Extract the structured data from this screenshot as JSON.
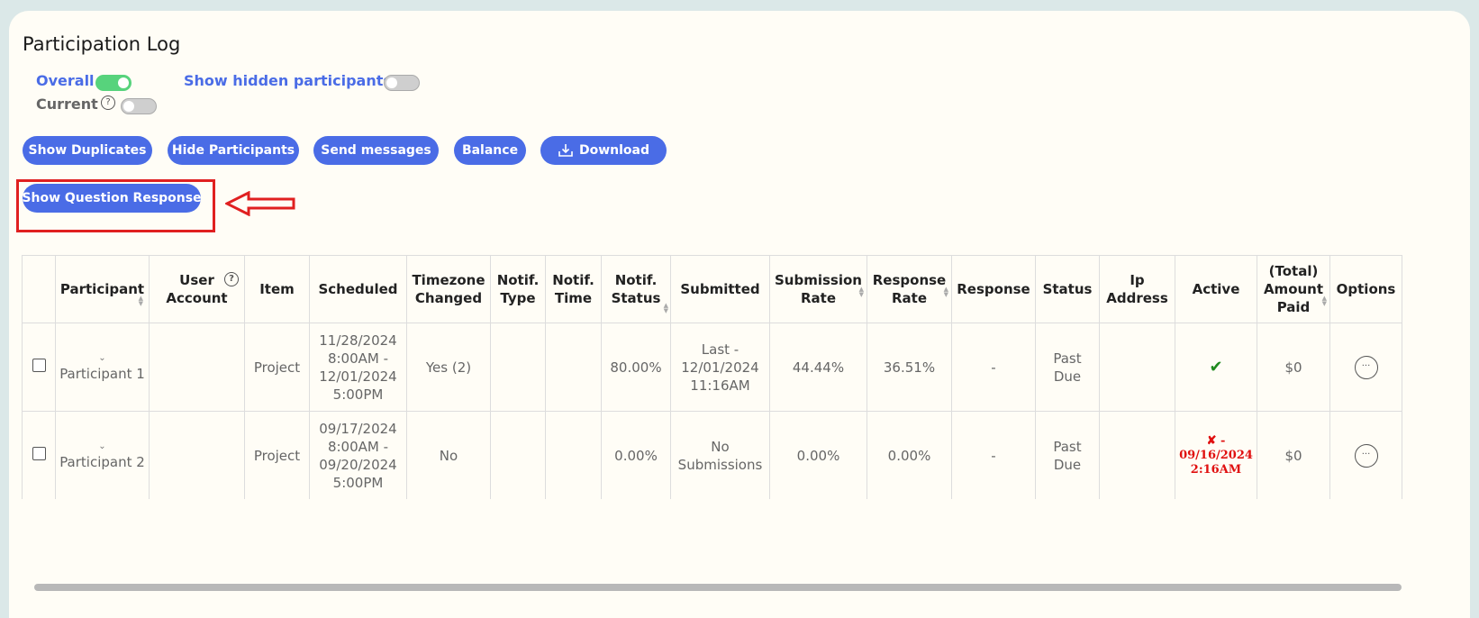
{
  "page": {
    "title": "Participation Log"
  },
  "toggles": {
    "overall_label": "Overall",
    "overall_on": true,
    "current_label": "Current",
    "current_on": false,
    "hidden_label": "Show hidden participants",
    "hidden_on": false,
    "help_glyph": "?"
  },
  "actions": {
    "show_duplicates": "Show Duplicates",
    "hide_participants": "Hide Participants",
    "send_messages": "Send messages",
    "balance": "Balance",
    "download": "Download",
    "show_question_response": "Show Question Response"
  },
  "table": {
    "headers": {
      "participant": "Participant",
      "user_account": "User Account",
      "item": "Item",
      "scheduled": "Scheduled",
      "timezone_changed": "Timezone Changed",
      "notif_type": "Notif. Type",
      "notif_time": "Notif. Time",
      "notif_status": "Notif. Status",
      "submitted": "Submitted",
      "submission_rate": "Submission Rate",
      "response_rate": "Response Rate",
      "response": "Response",
      "status": "Status",
      "ip_address": "Ip Address",
      "active": "Active",
      "total_amount_paid": "(Total) Amount Paid",
      "options": "Options"
    },
    "rows": [
      {
        "expand": "⌄",
        "participant": "Participant 1",
        "user_account": "",
        "item": "Project",
        "scheduled_1": "11/28/2024",
        "scheduled_2": "8:00AM -",
        "scheduled_3": "12/01/2024",
        "scheduled_4": "5:00PM",
        "timezone_changed": "Yes (2)",
        "notif_type": "",
        "notif_time": "",
        "notif_status": "80.00%",
        "submitted_1": "Last -",
        "submitted_2": "12/01/2024",
        "submitted_3": "11:16AM",
        "submission_rate": "44.44%",
        "response_rate": "36.51%",
        "response": "-",
        "status": "Past Due",
        "ip_address": "",
        "active": "✔",
        "amount_paid": "$0",
        "options": "···"
      },
      {
        "expand": "⌄",
        "participant": "Participant 2",
        "user_account": "",
        "item": "Project",
        "scheduled_1": "09/17/2024",
        "scheduled_2": "8:00AM -",
        "scheduled_3": "09/20/2024",
        "scheduled_4": "5:00PM",
        "timezone_changed": "No",
        "notif_type": "",
        "notif_time": "",
        "notif_status": "0.00%",
        "submitted_1": "No",
        "submitted_2": "Submissions",
        "submission_rate": "0.00%",
        "response_rate": "0.00%",
        "response": "-",
        "status": "Past Due",
        "ip_address": "",
        "active_mark": "✘",
        "active_dash": " -",
        "active_date": "09/16/2024",
        "active_time": "2:16AM",
        "amount_paid": "$0",
        "options": "···"
      }
    ]
  },
  "colors": {
    "accent": "#4a6ce6",
    "toggle_on": "#57d37c",
    "annotation": "#e02020",
    "success": "#1f8a1f",
    "danger": "#e01010"
  },
  "icons": [
    "help-icon",
    "download-icon",
    "sort-icon",
    "chevron-down-icon",
    "check-icon",
    "cross-icon",
    "more-options-icon",
    "annotation-arrow"
  ]
}
